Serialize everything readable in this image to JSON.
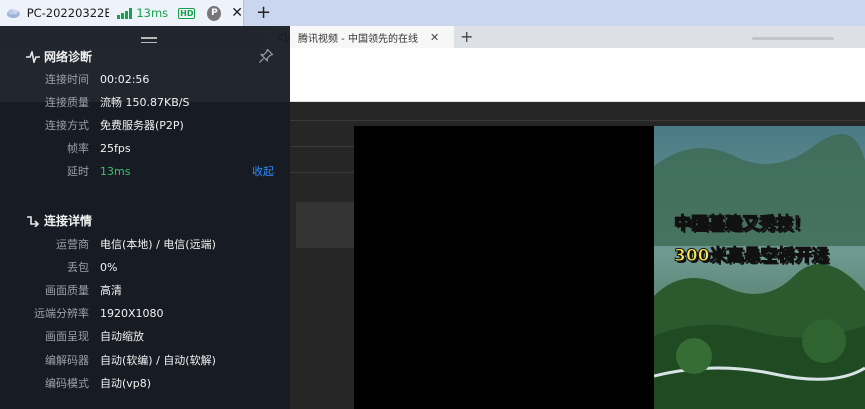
{
  "client_bar": {
    "tab_label": "PC-20220322E...",
    "latency": "13ms",
    "quality_badge": "HD",
    "profile_badge": "P",
    "close_symbol": "✕",
    "new_tab_symbol": "+",
    "colors": {
      "good": "#19a04b",
      "bar": "#c9d6ee"
    }
  },
  "remote_browser": {
    "active_tab_title": "腾讯视频 - 中国领先的在线",
    "close_symbol": "✕",
    "new_tab_symbol": "+",
    "video_caption_line1": "中国基建又秀技！",
    "video_caption_line2": "300米高悬空桥开远"
  },
  "diagnostics": {
    "network_section": {
      "title": "网络诊断",
      "rows": [
        {
          "label": "连接时间",
          "value": "00:02:56"
        },
        {
          "label": "连接质量",
          "value": "流畅 150.87KB/S"
        },
        {
          "label": "连接方式",
          "value": "免费服务器(P2P)"
        },
        {
          "label": "帧率",
          "value": "25fps"
        },
        {
          "label": "延时",
          "value": "13ms"
        }
      ],
      "collapse_label": "收起"
    },
    "details_section": {
      "title": "连接详情",
      "rows": [
        {
          "label": "运营商",
          "value": "电信(本地) / 电信(远端)"
        },
        {
          "label": "丢包",
          "value": "0%"
        },
        {
          "label": "画面质量",
          "value": "高清"
        },
        {
          "label": "远端分辨率",
          "value": "1920X1080"
        },
        {
          "label": "画面呈现",
          "value": "自动缩放"
        },
        {
          "label": "编解码器",
          "value": "自动(软编) / 自动(软解)"
        },
        {
          "label": "编码模式",
          "value": "自动(vp8)"
        }
      ]
    },
    "colors": {
      "accent_link": "#2f8cff",
      "good_value": "#3cc46a"
    }
  }
}
